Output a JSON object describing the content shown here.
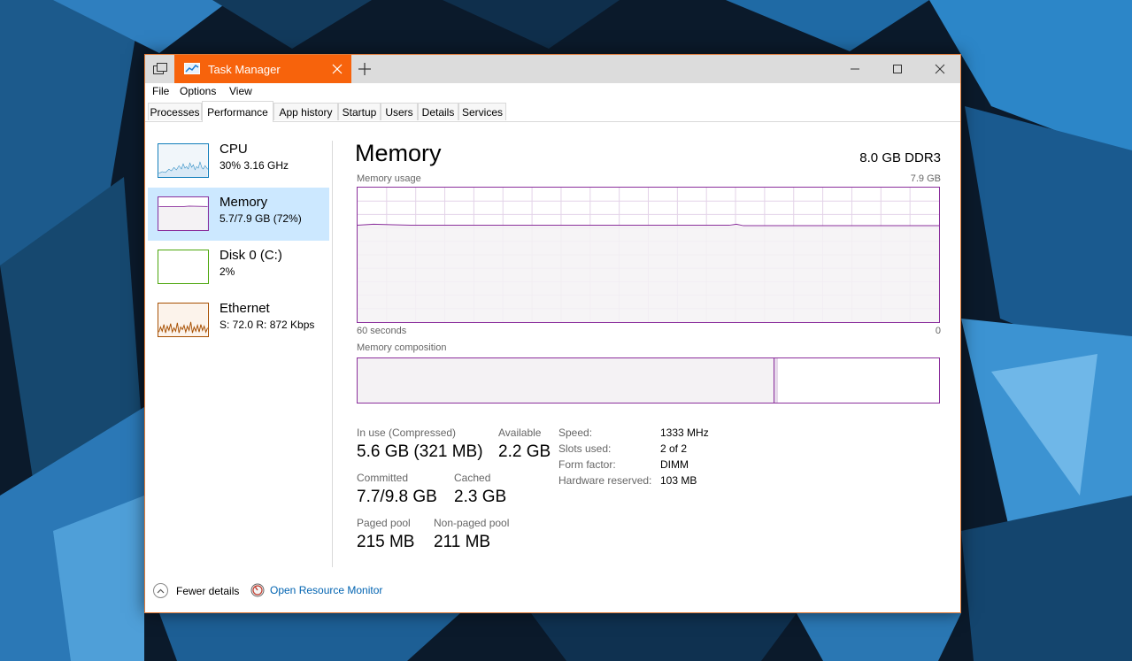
{
  "titlebar": {
    "title": "Task Manager"
  },
  "menubar": {
    "items": [
      "File",
      "Options",
      "View"
    ]
  },
  "tabs": [
    "Processes",
    "Performance",
    "App history",
    "Startup",
    "Users",
    "Details",
    "Services"
  ],
  "selected_tab": "Performance",
  "sidebar": {
    "items": [
      {
        "title": "CPU",
        "subtitle": "30% 3.16 GHz",
        "color": "#117dbb"
      },
      {
        "title": "Memory",
        "subtitle": "5.7/7.9 GB (72%)",
        "color": "#8b2f9c"
      },
      {
        "title": "Disk 0 (C:)",
        "subtitle": "2%",
        "color": "#4da60c"
      },
      {
        "title": "Ethernet",
        "subtitle": "S: 72.0  R: 872 Kbps",
        "color": "#a74f01"
      }
    ],
    "selected": 1
  },
  "main": {
    "title": "Memory",
    "spec": "8.0 GB DDR3",
    "usage_label": "Memory usage",
    "usage_max": "7.9 GB",
    "axis_left": "60 seconds",
    "axis_right": "0",
    "composition_label": "Memory composition",
    "composition": {
      "in_use_fraction": 0.715,
      "modified_fraction": 0.006
    },
    "usage_level_fraction": 0.72,
    "stats": {
      "in_use_label": "In use (Compressed)",
      "in_use_value": "5.6 GB (321 MB)",
      "available_label": "Available",
      "available_value": "2.2 GB",
      "committed_label": "Committed",
      "committed_value": "7.7/9.8 GB",
      "cached_label": "Cached",
      "cached_value": "2.3 GB",
      "paged_label": "Paged pool",
      "paged_value": "215 MB",
      "nonpaged_label": "Non-paged pool",
      "nonpaged_value": "211 MB"
    },
    "details": [
      {
        "label": "Speed:",
        "value": "1333 MHz"
      },
      {
        "label": "Slots used:",
        "value": "2 of 2"
      },
      {
        "label": "Form factor:",
        "value": "DIMM"
      },
      {
        "label": "Hardware reserved:",
        "value": "103 MB"
      }
    ]
  },
  "footer": {
    "fewer_details": "Fewer details",
    "resource_monitor": "Open Resource Monitor"
  },
  "colors": {
    "accent": "#f7630c",
    "memory": "#8b2f9c",
    "link": "#0063b1"
  }
}
